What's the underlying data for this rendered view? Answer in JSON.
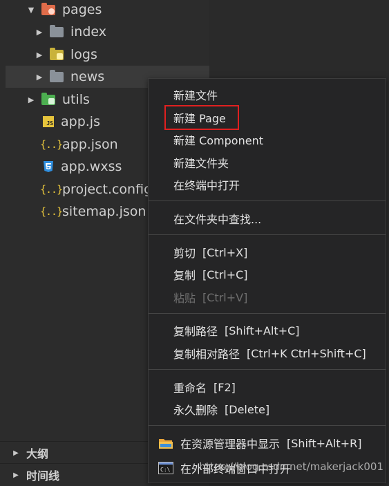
{
  "tree": {
    "items": [
      {
        "label": "pages",
        "expanded": true,
        "icon": "folder-pages-icon"
      },
      {
        "label": "index",
        "expanded": false,
        "icon": "folder-icon"
      },
      {
        "label": "logs",
        "expanded": false,
        "icon": "folder-logs-icon"
      },
      {
        "label": "news",
        "expanded": false,
        "icon": "folder-icon",
        "selected": true
      },
      {
        "label": "utils",
        "expanded": false,
        "icon": "folder-utils-icon"
      },
      {
        "label": "app.js",
        "icon": "js-file-icon"
      },
      {
        "label": "app.json",
        "icon": "json-file-icon"
      },
      {
        "label": "app.wxss",
        "icon": "css-file-icon"
      },
      {
        "label": "project.config",
        "icon": "json-file-icon"
      },
      {
        "label": "sitemap.json",
        "icon": "json-file-icon"
      }
    ]
  },
  "panels": [
    {
      "label": "大纲"
    },
    {
      "label": "时间线"
    }
  ],
  "context_menu": {
    "items": [
      {
        "label": "新建文件"
      },
      {
        "label": "新建 Page",
        "highlighted": true
      },
      {
        "label": "新建 Component"
      },
      {
        "label": "新建文件夹"
      },
      {
        "label": "在终端中打开"
      },
      {
        "label": "在文件夹中查找..."
      },
      {
        "label": "剪切",
        "shortcut": "[Ctrl+X]"
      },
      {
        "label": "复制",
        "shortcut": "[Ctrl+C]"
      },
      {
        "label": "粘贴",
        "shortcut": "[Ctrl+V]",
        "disabled": true
      },
      {
        "label": "复制路径",
        "shortcut": "[Shift+Alt+C]"
      },
      {
        "label": "复制相对路径",
        "shortcut": "[Ctrl+K Ctrl+Shift+C]"
      },
      {
        "label": "重命名",
        "shortcut": "[F2]"
      },
      {
        "label": "永久删除",
        "shortcut": "[Delete]"
      },
      {
        "label": "在资源管理器中显示",
        "shortcut": "[Shift+Alt+R]",
        "icon": "explorer-folder-icon"
      },
      {
        "label": "在外部终端窗口中打开",
        "icon": "terminal-icon"
      }
    ]
  },
  "watermark": "https://blog.csdn.net/makerjack001",
  "colors": {
    "highlight_border": "#e02020",
    "folder_gray": "#8a9199",
    "folder_orange": "#e06c4a",
    "folder_yellow": "#c9b23a",
    "folder_green": "#4caf50",
    "js_yellow": "#e6c43c",
    "css_blue": "#2f8fe0"
  }
}
